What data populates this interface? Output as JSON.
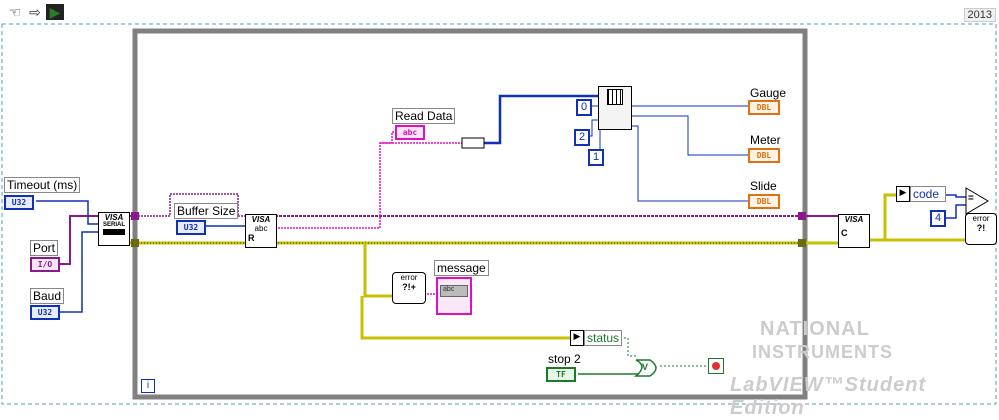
{
  "window": {
    "version": "2013",
    "toolbar_icons": [
      "grab-hand-icon",
      "arrow-icon",
      "run-icon"
    ]
  },
  "diagram": {
    "labels": {
      "timeout": "Timeout (ms)",
      "port": "Port",
      "baud": "Baud",
      "buffer_size": "Buffer Size",
      "read_data": "Read Data",
      "gauge": "Gauge",
      "meter": "Meter",
      "slide": "Slide",
      "message": "message",
      "status": "status",
      "stop": "stop 2",
      "code": "code"
    },
    "terminals": {
      "timeout_type": "U32",
      "port_type": "I/O",
      "baud_type": "U32",
      "buffer_type": "U32",
      "read_type": "abc",
      "gauge_type": "DBL",
      "meter_type": "DBL",
      "slide_type": "DBL",
      "stop_type": "TF",
      "message_type": "abc"
    },
    "constants": {
      "index0": "0",
      "index2": "2",
      "index1": "1",
      "four": "4"
    },
    "subvis": {
      "visa_config": "VISA",
      "visa_config_sub": "SERIAL",
      "visa_read": "VISA",
      "visa_read_sub": "abc",
      "visa_read_r": "R",
      "visa_close": "VISA",
      "visa_close_c": "C",
      "error_merge": "error",
      "error_merge2": "?!+",
      "error_handler": "error",
      "error_handler2": "?!",
      "or": "V",
      "equal": "="
    },
    "loop_iteration": "i",
    "watermark": {
      "line1": "NATIONAL",
      "line2": "INSTRUMENTS",
      "line3": "LabVIEW™Student Edition"
    },
    "colors": {
      "loop_border": "#808080",
      "u32_blue": "#1030b8",
      "dbl_orange": "#e07010",
      "string_pink": "#e010c0",
      "error_yellow": "#c8c000",
      "bool_green": "#1a7a2a",
      "visa_purple": "#8a1a8a"
    }
  }
}
